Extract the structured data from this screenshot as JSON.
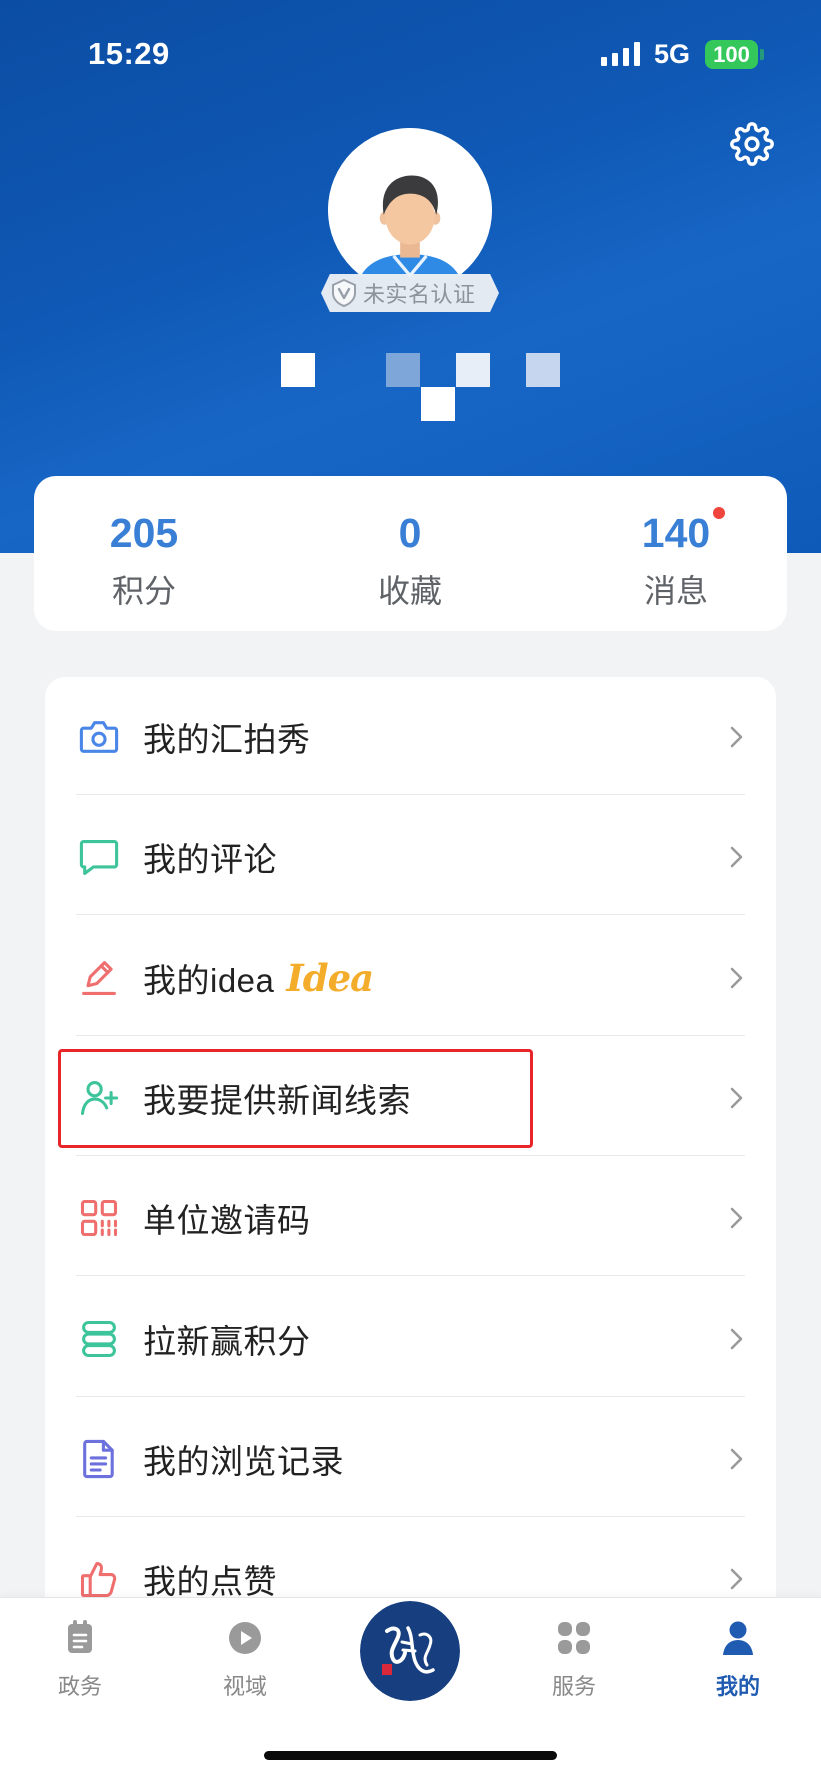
{
  "status_bar": {
    "time": "15:29",
    "network": "5G",
    "battery": "100",
    "signal_icon": "signal-icon"
  },
  "header": {
    "settings_icon": "gear-icon",
    "avatar_icon": "avatar-icon",
    "verify_badge": {
      "icon": "v-shield-icon",
      "label": "未实名认证"
    }
  },
  "stats": [
    {
      "value": "205",
      "label": "积分"
    },
    {
      "value": "0",
      "label": "收藏"
    },
    {
      "value": "140",
      "label": "消息",
      "unread_dot": true
    }
  ],
  "menu": {
    "items": [
      {
        "label": "我的汇拍秀",
        "icon": "camera-icon",
        "icon_color": "#4a86e8"
      },
      {
        "label": "我的评论",
        "icon": "comment-icon",
        "icon_color": "#3ec49b"
      },
      {
        "label": "我的idea",
        "tag": "Idea",
        "icon": "pencil-icon",
        "icon_color": "#ef6f6f"
      },
      {
        "label": "我要提供新闻线索",
        "icon": "add-user-icon",
        "icon_color": "#3ec49b",
        "highlighted": true
      },
      {
        "label": "单位邀请码",
        "icon": "qr-code-icon",
        "icon_color": "#ef6f6f"
      },
      {
        "label": "拉新赢积分",
        "icon": "coins-icon",
        "icon_color": "#3ec49b"
      },
      {
        "label": "我的浏览记录",
        "icon": "document-icon",
        "icon_color": "#6d71dd"
      },
      {
        "label": "我的点赞",
        "icon": "thumbs-up-icon",
        "icon_color": "#ef6f6f"
      }
    ]
  },
  "tabs": [
    {
      "label": "政务",
      "icon": "notebook-icon",
      "active": false
    },
    {
      "label": "视域",
      "icon": "play-icon",
      "active": false
    },
    {
      "label": "服务",
      "icon": "grid-icon",
      "active": false
    },
    {
      "label": "我的",
      "icon": "person-icon",
      "active": true
    }
  ],
  "center_logo": {
    "icon": "app-logo"
  },
  "colors": {
    "header_blue": "#0f58b4",
    "stat_number": "#3a7fd6",
    "unread_dot": "#f0443c",
    "highlight": "#e8262a",
    "tab_active": "#1f5bb0",
    "tab_inactive": "#9a9a9a",
    "battery": "#34c759",
    "idea_tag": "#f4ad2a"
  }
}
